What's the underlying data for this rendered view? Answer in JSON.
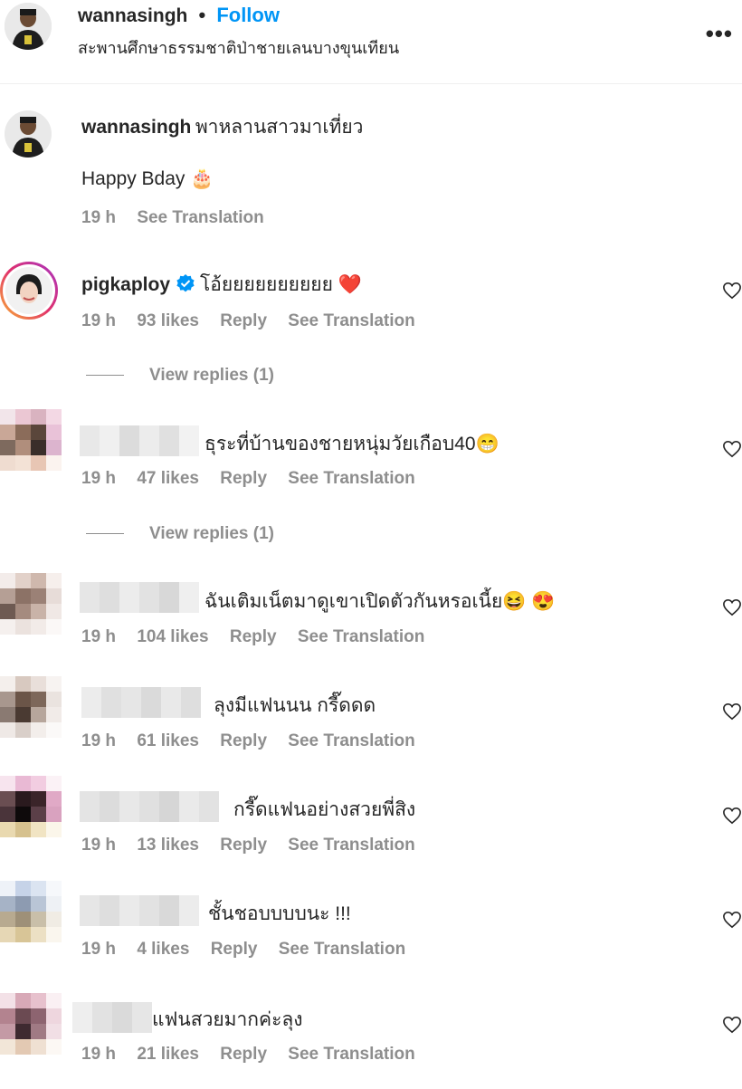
{
  "header": {
    "username": "wannasingh",
    "separator": "•",
    "follow_label": "Follow",
    "location": "สะพานศึกษาธรรมชาติป่าชายเลนบางขุนเทียน",
    "more_icon": "more-horizontal-icon"
  },
  "caption": {
    "username": "wannasingh",
    "text": "พาหลานสาวมาเที่ยว",
    "line2": "Happy Bday 🎂",
    "time": "19 h",
    "see_translation": "See Translation"
  },
  "comments": [
    {
      "username": "pigkaploy",
      "verified": true,
      "text": "โอ้ยยยยยยยยยย ❤️",
      "time": "19 h",
      "likes": "93 likes",
      "reply": "Reply",
      "see_translation": "See Translation"
    },
    {
      "username": "",
      "text": "ธุระที่บ้านของชายหนุ่มวัยเกือบ40😁",
      "time": "19 h",
      "likes": "47 likes",
      "reply": "Reply",
      "see_translation": "See Translation"
    },
    {
      "username": "",
      "text": "ฉันเติมเน็ตมาดูเขาเปิดตัวกันหรอเนี้ย😆 😍",
      "time": "19 h",
      "likes": "104 likes",
      "reply": "Reply",
      "see_translation": "See Translation"
    },
    {
      "username": "",
      "text": "ลุงมีแฟนนน กรี๊ดดด",
      "time": "19 h",
      "likes": "61 likes",
      "reply": "Reply",
      "see_translation": "See Translation"
    },
    {
      "username": "",
      "text": "กรี๊ดแฟนอย่างสวยพี่สิง",
      "time": "19 h",
      "likes": "13 likes",
      "reply": "Reply",
      "see_translation": "See Translation"
    },
    {
      "username": "",
      "text": "ชั้นชอบบบบนะ !!!",
      "time": "19 h",
      "likes": "4 likes",
      "reply": "Reply",
      "see_translation": "See Translation"
    },
    {
      "username": "",
      "text": "แฟนสวยมากค่ะลุง",
      "time": "19 h",
      "likes": "21 likes",
      "reply": "Reply",
      "see_translation": "See Translation"
    }
  ],
  "view_replies": [
    "View replies (1)",
    "View replies (1)"
  ],
  "colors": {
    "follow": "#0095f6",
    "muted": "#8e8e8e",
    "heart": "#ed4956",
    "verified": "#0095f6"
  }
}
